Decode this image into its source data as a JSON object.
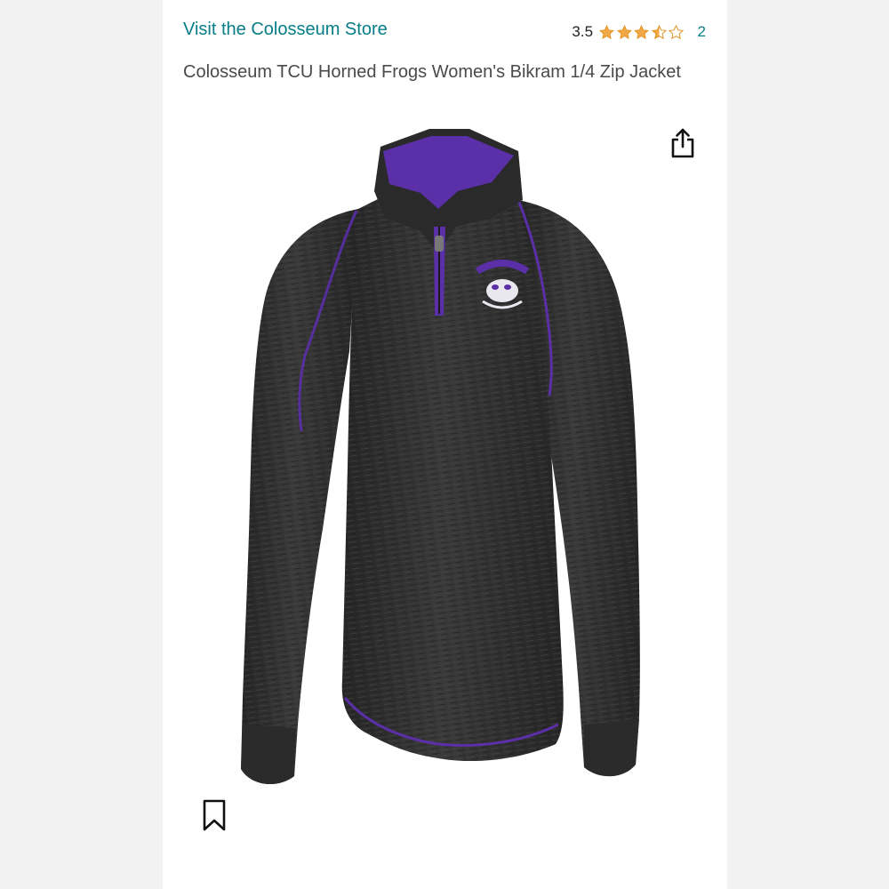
{
  "store_link": "Visit the Colosseum Store",
  "rating": {
    "value": "3.5",
    "stars_filled": 3.5,
    "stars_max": 5,
    "count": "2",
    "star_color": "#f3a847"
  },
  "product": {
    "title": "Colosseum TCU Horned Frogs Women's Bikram 1/4 Zip Jacket",
    "image_alt": "Charcoal heather quarter-zip pullover with purple trim"
  },
  "icons": {
    "share": "share-icon",
    "save": "bookmark-icon"
  },
  "colors": {
    "link": "#067d87",
    "title_text": "#4a4a4a",
    "jacket_body": "#2f2f2f",
    "trim": "#5a2fa8"
  }
}
